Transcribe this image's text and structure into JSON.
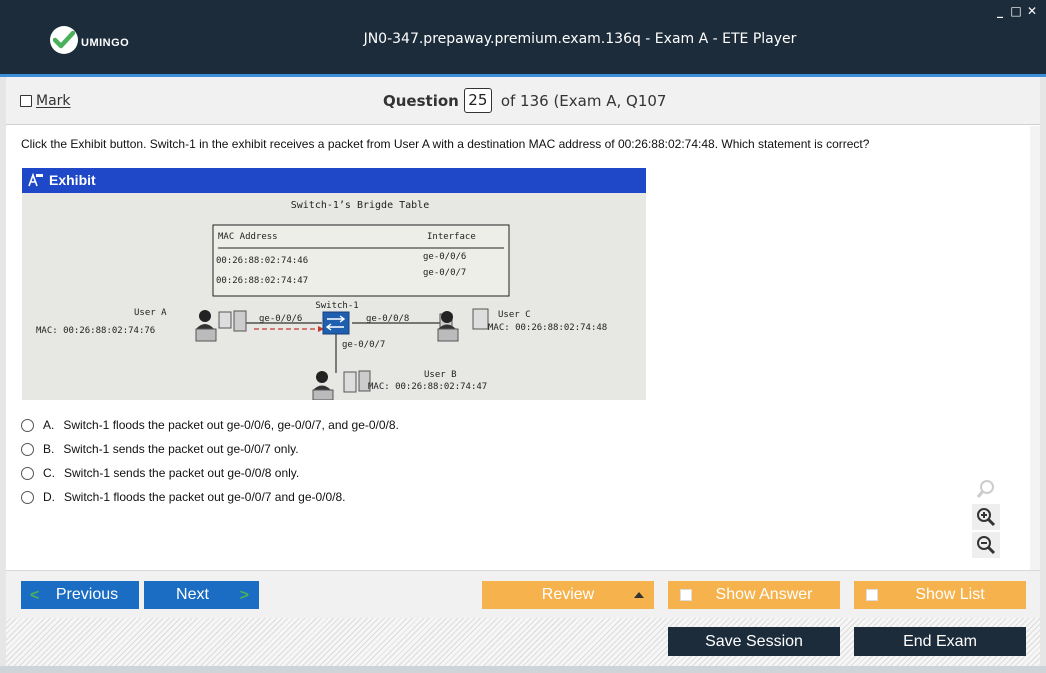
{
  "window": {
    "title": "JN0-347.prepaway.premium.exam.136q - Exam A - ETE Player",
    "logo_text": "UMINGO",
    "controls": [
      "_",
      "□",
      "✕"
    ]
  },
  "header": {
    "mark_label": "Mark",
    "question_label": "Question",
    "question_number": "25",
    "of_text": "of 136 (Exam A, Q107"
  },
  "question": {
    "text": "Click the Exhibit button. Switch-1 in the exhibit receives a packet from User A with a destination MAC address of 00:26:88:02:74:48. Which statement is correct?"
  },
  "exhibit": {
    "title": "Exhibit",
    "table_title": "Switch-1’s Brigde Table",
    "col_mac": "MAC Address",
    "col_iface": "Interface",
    "row1_mac": "00:26:88:02:74:46",
    "row1_iface": "ge-0/0/6",
    "row2_mac": "00:26:88:02:74:47",
    "row2_iface": "ge-0/0/7",
    "switch_label": "Switch-1",
    "user_a": "User A",
    "user_a_mac": "MAC: 00:26:88:02:74:76",
    "user_b": "User B",
    "user_b_mac": "MAC: 00:26:88:02:74:47",
    "user_c": "User C",
    "user_c_mac": "MAC: 00:26:88:02:74:48",
    "port_a": "ge-0/0/6",
    "port_b": "ge-0/0/7",
    "port_c": "ge-0/0/8"
  },
  "answers": [
    {
      "letter": "A.",
      "text": "Switch-1 floods the packet out ge-0/0/6, ge-0/0/7, and ge-0/0/8."
    },
    {
      "letter": "B.",
      "text": "Switch-1 sends the packet out ge-0/0/7 only."
    },
    {
      "letter": "C.",
      "text": "Switch-1 sends the packet out ge-0/0/8 only."
    },
    {
      "letter": "D.",
      "text": "Switch-1 floods the packet out ge-0/0/7 and ge-0/0/8."
    }
  ],
  "zoom": {
    "icons": [
      "magnifier-icon",
      "zoom-in-icon",
      "zoom-out-icon"
    ]
  },
  "nav": {
    "previous": "Previous",
    "next": "Next",
    "review": "Review",
    "show_answer": "Show Answer",
    "show_list": "Show List"
  },
  "footer": {
    "save_session": "Save Session",
    "end_exam": "End Exam"
  },
  "colors": {
    "titlebar": "#1c2c3b",
    "accent_blue": "#1a6dc2",
    "accent_orange": "#f6b24d",
    "exhibit_blue": "#1e48c7",
    "logo_green": "#49b05c"
  }
}
